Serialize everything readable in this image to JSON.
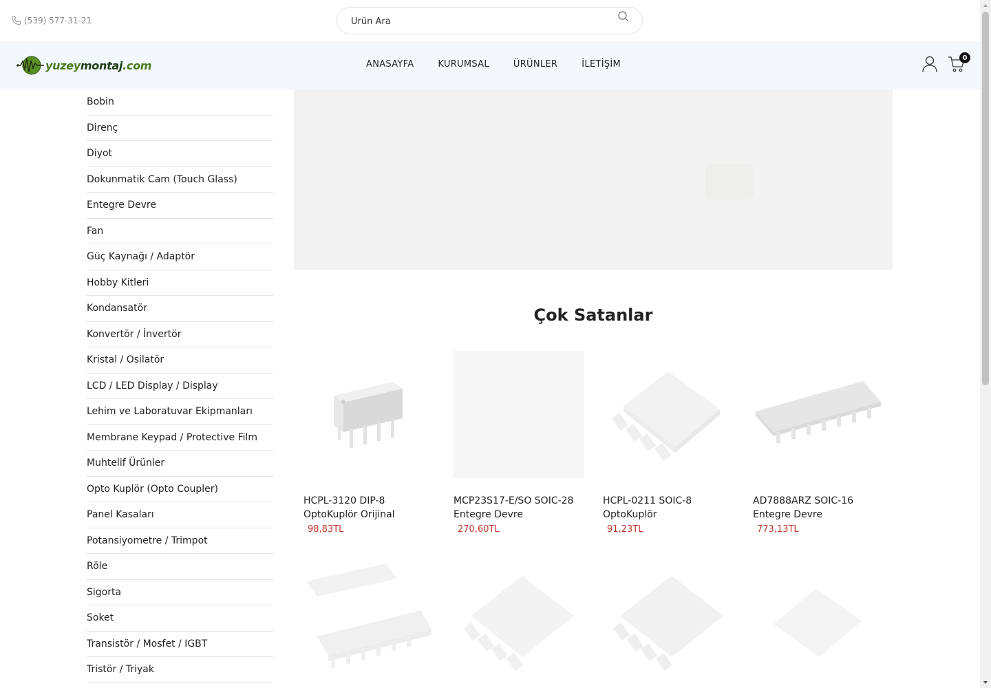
{
  "topbar": {
    "phone": "(539) 577-31-21",
    "search_placeholder": "Ürün Ara"
  },
  "header": {
    "logo": {
      "part1": "yuzey",
      "part2": "montaj",
      "part3": ".com"
    },
    "nav": [
      "ANASAYFA",
      "KURUMSAL",
      "ÜRÜNLER",
      "İLETİŞİM"
    ],
    "cart_count": "0"
  },
  "sidebar": {
    "categories": [
      "Bobin",
      "Direnç",
      "Diyot",
      "Dokunmatik Cam (Touch Glass)",
      "Entegre Devre",
      "Fan",
      "Güç Kaynağı / Adaptör",
      "Hobby Kitleri",
      "Kondansatör",
      "Konvertör / İnvertör",
      "Kristal / Osilatör",
      "LCD / LED Display / Display",
      "Lehim ve Laboratuvar Ekipmanları",
      "Membrane Keypad / Protective Film",
      "Muhtelif Ürünler",
      "Opto Kuplör (Opto Coupler)",
      "Panel Kasaları",
      "Potansiyometre / Trimpot",
      "Röle",
      "Sigorta",
      "Soket",
      "Transistör / Mosfet / IGBT",
      "Tristör / Triyak"
    ]
  },
  "main": {
    "section_title": "Çok Satanlar",
    "products": [
      {
        "name": "HCPL-3120 DIP-8 OptoKuplör Orijinal",
        "price": "98,83TL",
        "image": "dip8-chip"
      },
      {
        "name": "MCP23S17-E/SO SOIC-28 Entegre Devre",
        "price": "270,60TL",
        "image": "blank"
      },
      {
        "name": "HCPL-0211 SOIC-8 OptoKuplör",
        "price": "91,23TL",
        "image": "soic8-chip"
      },
      {
        "name": "AD7888ARZ SOIC-16 Entegre Devre",
        "price": "773,13TL",
        "image": "soic16-chip"
      }
    ]
  },
  "colors": {
    "header_bg": "#f3f8fc",
    "price": "#c0352b",
    "logo_green": "#4a7a1e"
  }
}
